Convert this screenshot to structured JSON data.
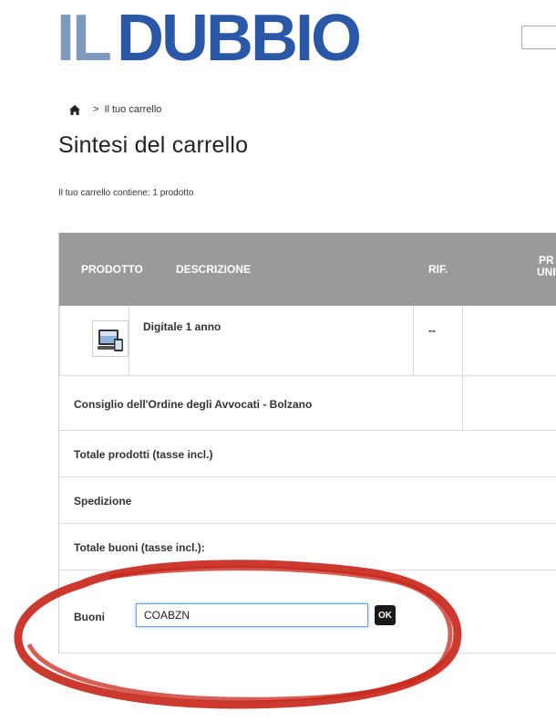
{
  "header": {
    "logo_text_il": "IL",
    "logo_text_dubbio": "DUBBIO",
    "brand_colors": {
      "il": "#7f98bd",
      "dubbio": "#2a58a6"
    }
  },
  "breadcrumb": {
    "home_icon": "home-icon",
    "separator": ">",
    "current": "Il tuo carrello"
  },
  "page": {
    "title": "Sintesi del carrello",
    "summary": "Il tuo carrello contiene: 1 prodotto"
  },
  "table": {
    "headers": [
      "PRODOTTO",
      "DESCRIZIONE",
      "RIF.",
      "PR",
      "UNI"
    ],
    "header_color": "#9a9a9a",
    "product": {
      "thumbnail_icon": "digital-devices-icon",
      "name": "Digitale 1 anno",
      "ref": "--"
    },
    "voucher_line": "Consiglio dell'Ordine degli Avvocati - Bolzano",
    "totals": [
      "Totale prodotti (tasse incl.)",
      "Spedizione",
      "Totale buoni (tasse incl.):"
    ],
    "buoni": {
      "label": "Buoni",
      "value": "COABZN",
      "ok_label": "OK"
    }
  },
  "annotation": {
    "type": "hand-drawn-ellipse",
    "color": "#c8281c"
  }
}
